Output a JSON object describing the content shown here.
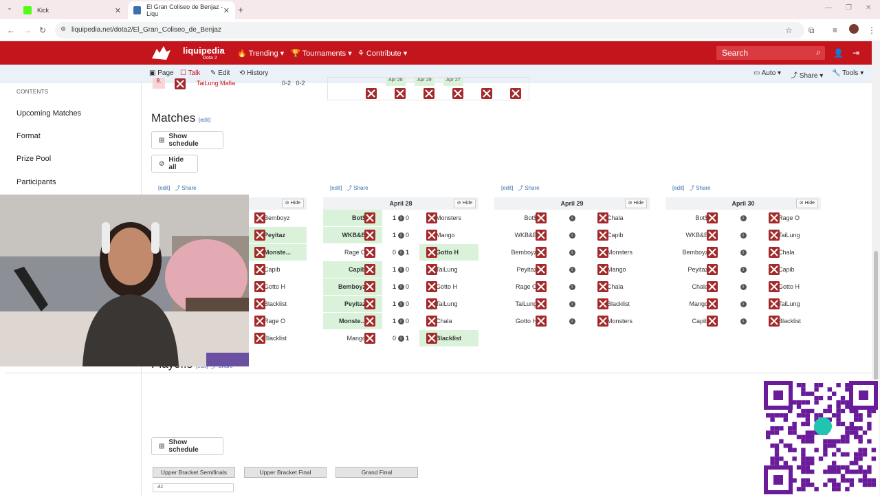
{
  "browser": {
    "tabs": [
      {
        "title": "Kick"
      },
      {
        "title": "El Gran Coliseo de Benjaz - Liqu"
      }
    ],
    "url": "liquipedia.net/dota2/El_Gran_Coliseo_de_Benjaz"
  },
  "header": {
    "logo": "liquipedia",
    "logo_sub": "Dota 2",
    "nav": [
      "Trending",
      "Tournaments",
      "Contribute"
    ],
    "search_placeholder": "Search"
  },
  "pagetabs": {
    "page": "Page",
    "talk": "Talk",
    "edit": "Edit",
    "history": "History",
    "auto": "Auto",
    "share": "Share",
    "tools": "Tools"
  },
  "sidebar": {
    "heading": "CONTENTS",
    "items": [
      "Upcoming Matches",
      "Format",
      "Prize Pool",
      "Participants"
    ]
  },
  "standings_partial": {
    "rank": "8.",
    "team": "TaiLung Mafia",
    "score": "0-2",
    "score2": "0-2",
    "dates": [
      "Apr 28",
      "Apr 29",
      "Apr 27"
    ]
  },
  "matches": {
    "heading": "Matches",
    "edit": "[edit]",
    "share": "Share",
    "show_schedule": "Show schedule",
    "hide_all": "Hide all",
    "hide": "Hide",
    "columns": [
      {
        "date": "",
        "rows": [
          {
            "t1": "",
            "t2": "Bemboyz",
            "s1": "",
            "s2": "",
            "win": 0
          },
          {
            "t1": "",
            "t2": "Peyitaz",
            "s1": "",
            "s2": "",
            "win": 2
          },
          {
            "t1": "",
            "t2": "Monste...",
            "s1": "",
            "s2": "",
            "win": 2
          },
          {
            "t1": "",
            "t2": "Capib",
            "s1": "",
            "s2": "",
            "win": 0
          },
          {
            "t1": "",
            "t2": "Gotto H",
            "s1": "",
            "s2": "",
            "win": 0
          },
          {
            "t1": "",
            "t2": "Blacklist",
            "s1": "",
            "s2": "",
            "win": 0
          },
          {
            "t1": "",
            "t2": "Rage O",
            "s1": "",
            "s2": "",
            "win": 0
          },
          {
            "t1": "",
            "t2": "Blacklist",
            "s1": "",
            "s2": "",
            "win": 0
          }
        ]
      },
      {
        "date": "April 28",
        "rows": [
          {
            "t1": "Bot$",
            "t2": "Monsters",
            "s1": "1",
            "s2": "0",
            "win": 1
          },
          {
            "t1": "WKB&B",
            "t2": "Mango",
            "s1": "1",
            "s2": "0",
            "win": 1
          },
          {
            "t1": "Rage O",
            "t2": "Gotto H",
            "s1": "0",
            "s2": "1",
            "win": 2
          },
          {
            "t1": "Capib",
            "t2": "TaiLung",
            "s1": "1",
            "s2": "0",
            "win": 1
          },
          {
            "t1": "Bemboyz",
            "t2": "Gotto H",
            "s1": "1",
            "s2": "0",
            "win": 1
          },
          {
            "t1": "Peyitaz",
            "t2": "TaiLung",
            "s1": "1",
            "s2": "0",
            "win": 1
          },
          {
            "t1": "Monste...",
            "t2": "Chala",
            "s1": "1",
            "s2": "0",
            "win": 1
          },
          {
            "t1": "Mango",
            "t2": "Blacklist",
            "s1": "0",
            "s2": "1",
            "win": 2
          }
        ]
      },
      {
        "date": "April 29",
        "rows": [
          {
            "t1": "Bot$",
            "t2": "Chala",
            "s1": "",
            "s2": "",
            "win": 0
          },
          {
            "t1": "WKB&B",
            "t2": "Capib",
            "s1": "",
            "s2": "",
            "win": 0
          },
          {
            "t1": "Bemboyz",
            "t2": "Monsters",
            "s1": "",
            "s2": "",
            "win": 0
          },
          {
            "t1": "Peyitaz",
            "t2": "Mango",
            "s1": "",
            "s2": "",
            "win": 0
          },
          {
            "t1": "Rage O",
            "t2": "Chala",
            "s1": "",
            "s2": "",
            "win": 0
          },
          {
            "t1": "TaiLung",
            "t2": "Blacklist",
            "s1": "",
            "s2": "",
            "win": 0
          },
          {
            "t1": "Gotto H",
            "t2": "Monsters",
            "s1": "",
            "s2": "",
            "win": 0
          }
        ]
      },
      {
        "date": "April 30",
        "rows": [
          {
            "t1": "Bot$",
            "t2": "Rage O",
            "s1": "",
            "s2": "",
            "win": 0
          },
          {
            "t1": "WKB&B",
            "t2": "TaiLung",
            "s1": "",
            "s2": "",
            "win": 0
          },
          {
            "t1": "Bemboyz",
            "t2": "Chala",
            "s1": "",
            "s2": "",
            "win": 0
          },
          {
            "t1": "Peyitaz",
            "t2": "Capib",
            "s1": "",
            "s2": "",
            "win": 0
          },
          {
            "t1": "Chala",
            "t2": "Gotto H",
            "s1": "",
            "s2": "",
            "win": 0
          },
          {
            "t1": "Mango",
            "t2": "TaiLung",
            "s1": "",
            "s2": "",
            "win": 0
          },
          {
            "t1": "Capib",
            "t2": "Blacklist",
            "s1": "",
            "s2": "",
            "win": 0
          }
        ]
      }
    ]
  },
  "playoffs": {
    "heading": "Playoffs",
    "edit": "[edit]",
    "share": "Share",
    "show_schedule": "Show schedule",
    "rounds": [
      "Upper Bracket Semifinals",
      "Upper Bracket Final",
      "Grand Final"
    ],
    "first_slot": "A1"
  },
  "colors": {
    "brand": "#c4151c",
    "win": "#d9f2d9",
    "link": "#3a6fb0"
  }
}
